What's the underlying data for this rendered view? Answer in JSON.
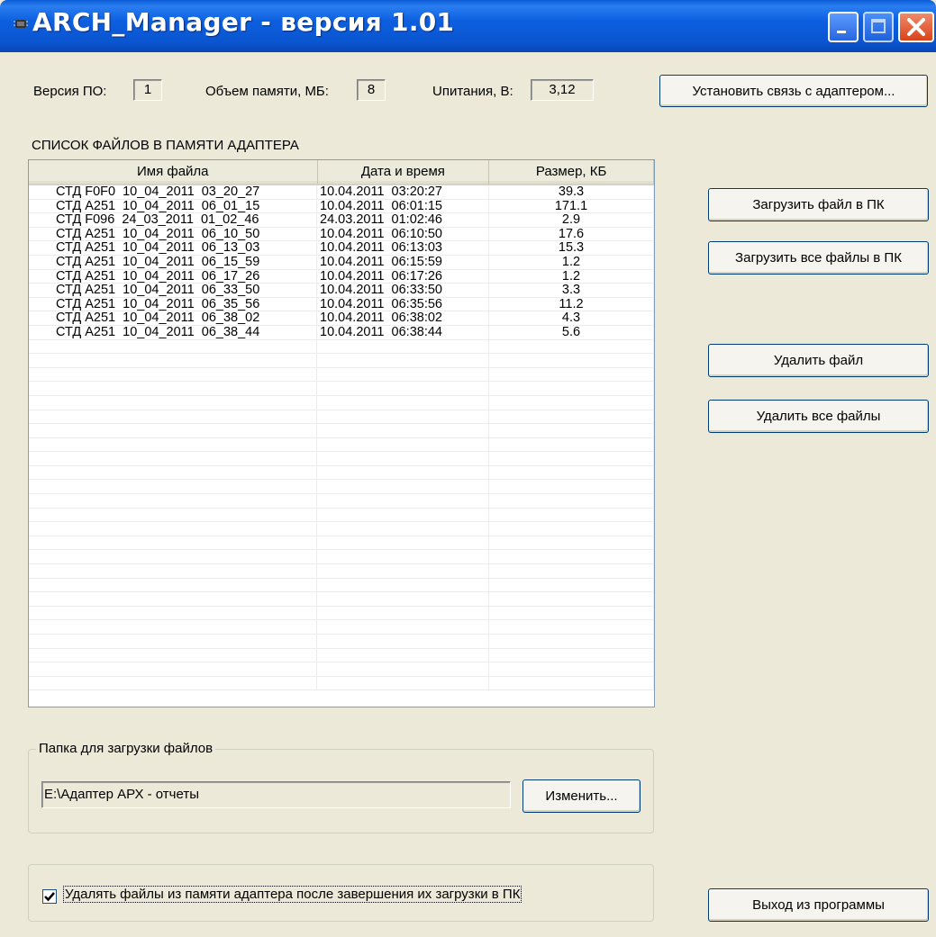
{
  "window": {
    "title": "ARCH_Manager - версия 1.01"
  },
  "info": {
    "version_label": "Версия ПО:",
    "version_value": "1",
    "memory_label": "Объем памяти, МБ:",
    "memory_value": "8",
    "voltage_label": "Uпитания, В:",
    "voltage_value": "3,12"
  },
  "buttons": {
    "connect": "Установить связь с адаптером...",
    "load_file": "Загрузить файл в ПК",
    "load_all": "Загрузить все файлы в ПК",
    "delete_file": "Удалить файл",
    "delete_all": "Удалить все файлы",
    "change": "Изменить...",
    "exit": "Выход из программы"
  },
  "file_list": {
    "title": "СПИСОК ФАЙЛОВ В ПАМЯТИ АДАПТЕРА",
    "columns": [
      "Имя файла",
      "Дата и время",
      "Размер, КБ"
    ],
    "rows": [
      [
        "СТД F0F0  10_04_2011  03_20_27",
        "10.04.2011  03:20:27",
        "39.3"
      ],
      [
        "СТД A251  10_04_2011  06_01_15",
        "10.04.2011  06:01:15",
        "171.1"
      ],
      [
        "СТД F096  24_03_2011  01_02_46",
        "24.03.2011  01:02:46",
        "2.9"
      ],
      [
        "СТД A251  10_04_2011  06_10_50",
        "10.04.2011  06:10:50",
        "17.6"
      ],
      [
        "СТД A251  10_04_2011  06_13_03",
        "10.04.2011  06:13:03",
        "15.3"
      ],
      [
        "СТД A251  10_04_2011  06_15_59",
        "10.04.2011  06:15:59",
        "1.2"
      ],
      [
        "СТД A251  10_04_2011  06_17_26",
        "10.04.2011  06:17:26",
        "1.2"
      ],
      [
        "СТД A251  10_04_2011  06_33_50",
        "10.04.2011  06:33:50",
        "3.3"
      ],
      [
        "СТД A251  10_04_2011  06_35_56",
        "10.04.2011  06:35:56",
        "11.2"
      ],
      [
        "СТД A251  10_04_2011  06_38_02",
        "10.04.2011  06:38:02",
        "4.3"
      ],
      [
        "СТД A251  10_04_2011  06_38_44",
        "10.04.2011  06:38:44",
        "5.6"
      ]
    ]
  },
  "folder": {
    "group_label": "Папка для загрузки файлов",
    "path": "E:\\Адаптер АРХ - отчеты"
  },
  "options": {
    "delete_after_load_label": "Удалять файлы из памяти адаптера после завершения их загрузки в ПК",
    "delete_after_load_checked": true
  }
}
